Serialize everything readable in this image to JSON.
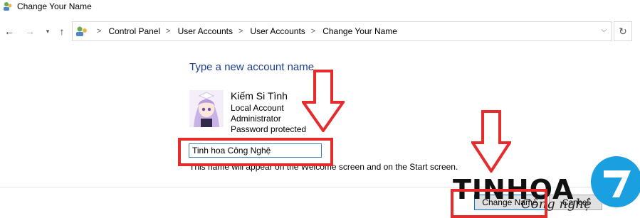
{
  "window": {
    "title": "Change Your Name",
    "title_icon": "user-accounts-icon"
  },
  "nav": {
    "back_icon": "back-arrow-icon",
    "forward_icon": "forward-arrow-icon",
    "recent_icon": "chevron-down-icon",
    "up_icon": "up-arrow-icon",
    "refresh_icon": "refresh-icon",
    "address_icon": "user-accounts-icon",
    "breadcrumb": [
      "Control Panel",
      "User Accounts",
      "User Accounts",
      "Change Your Name"
    ],
    "separator": ">"
  },
  "main": {
    "heading": "Type a new account name",
    "account": {
      "name": "Kiếm Si Tình",
      "lines": [
        "Local Account",
        "Administrator",
        "Password protected"
      ]
    },
    "name_input_value": "Tinh hoa Công Nghệ",
    "hint": "This name will appear on the Welcome screen and on the Start screen."
  },
  "buttons": {
    "change_name": "Change Name",
    "cancel": "Cancel"
  },
  "watermark": {
    "brand": "TINHOA",
    "tagline": "Công nghệ",
    "logo_mark": "7"
  },
  "colors": {
    "heading": "#1e3d8f",
    "annotation_red": "#e52b2b",
    "logo_blue": "#1a9fe0",
    "input_border": "#3c7fb1"
  }
}
